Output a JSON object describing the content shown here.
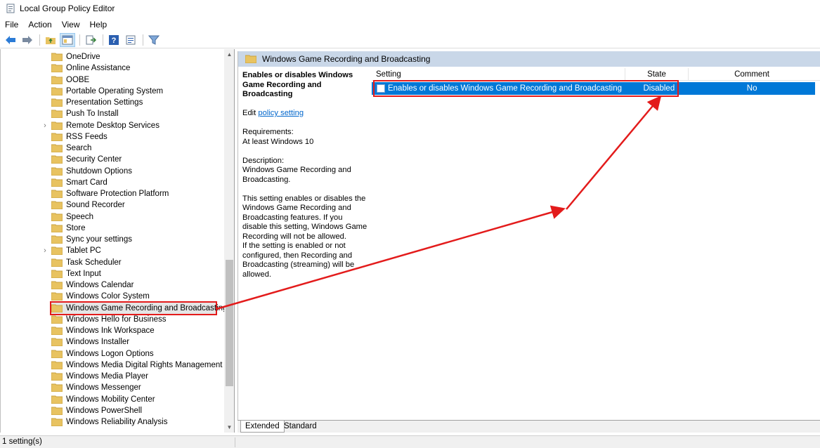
{
  "window": {
    "title": "Local Group Policy Editor"
  },
  "menu": {
    "items": [
      "File",
      "Action",
      "View",
      "Help"
    ]
  },
  "toolbar": {
    "icons": [
      "back-arrow-icon",
      "forward-arrow-icon",
      "up-folder-icon",
      "show-hide-tree-icon",
      "export-list-icon",
      "help-icon",
      "properties-icon",
      "filter-icon"
    ]
  },
  "tree": {
    "items": [
      {
        "label": "OneDrive",
        "expandable": false
      },
      {
        "label": "Online Assistance",
        "expandable": false
      },
      {
        "label": "OOBE",
        "expandable": false
      },
      {
        "label": "Portable Operating System",
        "expandable": false
      },
      {
        "label": "Presentation Settings",
        "expandable": false
      },
      {
        "label": "Push To Install",
        "expandable": false
      },
      {
        "label": "Remote Desktop Services",
        "expandable": true
      },
      {
        "label": "RSS Feeds",
        "expandable": false
      },
      {
        "label": "Search",
        "expandable": false
      },
      {
        "label": "Security Center",
        "expandable": false
      },
      {
        "label": "Shutdown Options",
        "expandable": false
      },
      {
        "label": "Smart Card",
        "expandable": false
      },
      {
        "label": "Software Protection Platform",
        "expandable": false
      },
      {
        "label": "Sound Recorder",
        "expandable": false
      },
      {
        "label": "Speech",
        "expandable": false
      },
      {
        "label": "Store",
        "expandable": false
      },
      {
        "label": "Sync your settings",
        "expandable": false
      },
      {
        "label": "Tablet PC",
        "expandable": true
      },
      {
        "label": "Task Scheduler",
        "expandable": false
      },
      {
        "label": "Text Input",
        "expandable": false
      },
      {
        "label": "Windows Calendar",
        "expandable": false
      },
      {
        "label": "Windows Color System",
        "expandable": false
      },
      {
        "label": "Windows Game Recording and Broadcasting",
        "expandable": false,
        "selected": true
      },
      {
        "label": "Windows Hello for Business",
        "expandable": false
      },
      {
        "label": "Windows Ink Workspace",
        "expandable": false
      },
      {
        "label": "Windows Installer",
        "expandable": false
      },
      {
        "label": "Windows Logon Options",
        "expandable": false
      },
      {
        "label": "Windows Media Digital Rights Management",
        "expandable": false
      },
      {
        "label": "Windows Media Player",
        "expandable": false
      },
      {
        "label": "Windows Messenger",
        "expandable": false
      },
      {
        "label": "Windows Mobility Center",
        "expandable": false
      },
      {
        "label": "Windows PowerShell",
        "expandable": false
      },
      {
        "label": "Windows Reliability Analysis",
        "expandable": false
      }
    ]
  },
  "details": {
    "header_title": "Windows Game Recording and Broadcasting",
    "policy_title": "Enables or disables Windows Game Recording and Broadcasting",
    "edit_prefix": "Edit ",
    "edit_link": "policy setting",
    "requirements_label": "Requirements:",
    "requirements_value": "At least Windows 10",
    "description_label": "Description:",
    "description_short": "Windows Game Recording and Broadcasting.",
    "description_long_1": "This setting enables or disables the Windows Game Recording and Broadcasting features. If you disable this setting, Windows Game Recording will not be allowed.",
    "description_long_2": "If the setting is enabled or not configured, then Recording and Broadcasting (streaming) will be allowed."
  },
  "list": {
    "columns": {
      "setting": "Setting",
      "state": "State",
      "comment": "Comment"
    },
    "rows": [
      {
        "setting": "Enables or disables Windows Game Recording and Broadcasting",
        "state": "Disabled",
        "comment": "No"
      }
    ]
  },
  "tabs": {
    "extended": "Extended",
    "standard": "Standard"
  },
  "status": {
    "text": "1 setting(s)"
  },
  "colors": {
    "highlight_red": "#e31b1b",
    "selection_blue": "#0078d7",
    "header_blue": "#c9d7e8"
  }
}
